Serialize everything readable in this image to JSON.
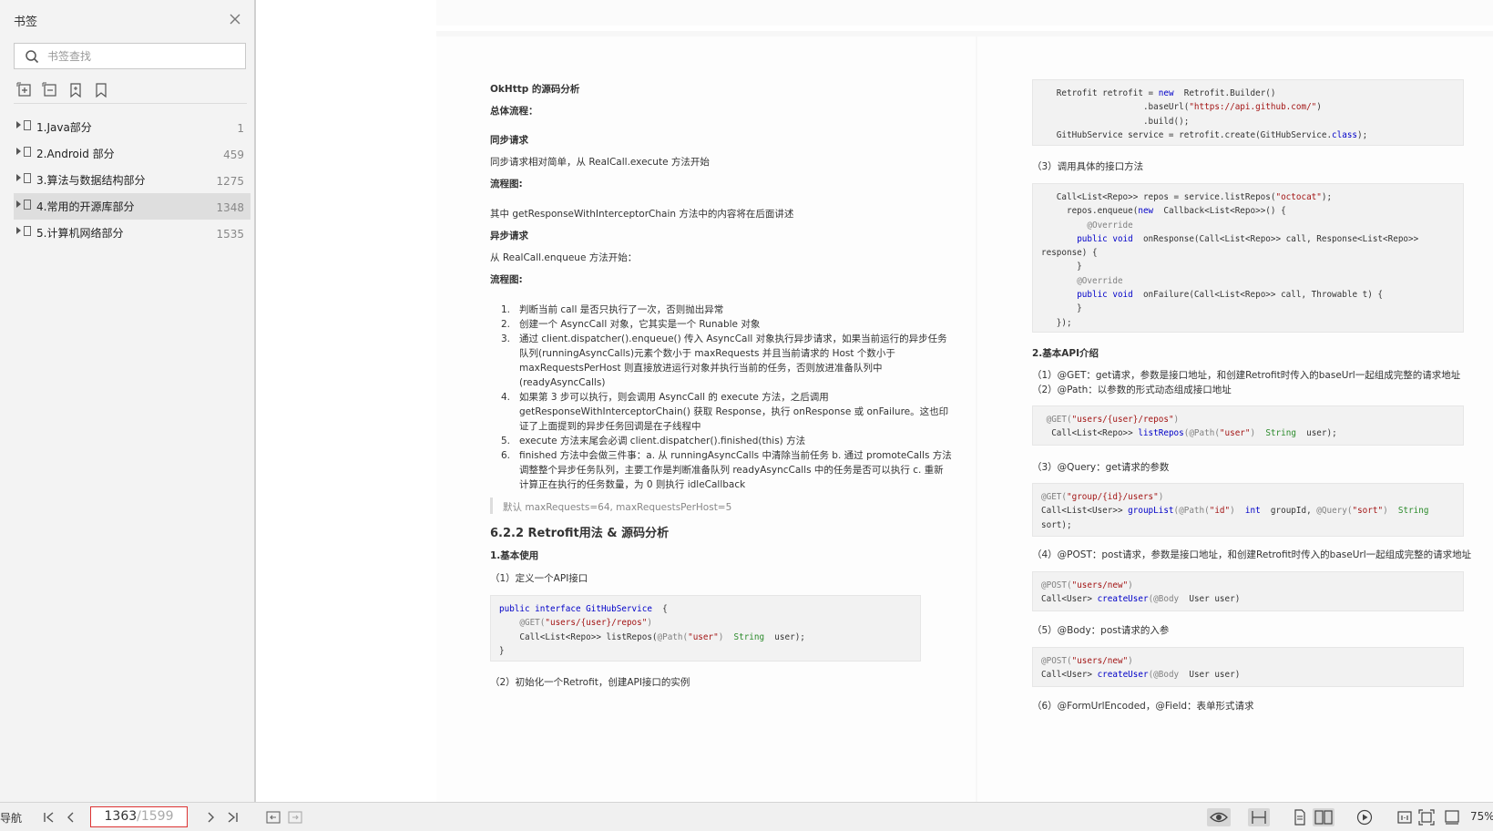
{
  "sidebar": {
    "title": "书签",
    "search_placeholder": "书签查找",
    "items": [
      {
        "label": "1.Java部分",
        "page": "1"
      },
      {
        "label": "2.Android 部分",
        "page": "459"
      },
      {
        "label": "3.算法与数据结构部分",
        "page": "1275"
      },
      {
        "label": "4.常用的开源库部分",
        "page": "1348"
      },
      {
        "label": "5.计算机网络部分",
        "page": "1535"
      }
    ]
  },
  "left_page": {
    "h_okhttp": "OkHttp 的源码分析",
    "overall_flow": "总体流程：",
    "sync_title": "同步请求",
    "sync_desc": "同步请求相对简单，从 RealCall.execute 方法开始",
    "flowchart1": "流程图:",
    "intercept_note": "其中 getResponseWithInterceptorChain 方法中的内容将在后面讲述",
    "async_title": "异步请求",
    "async_desc": "从 RealCall.enqueue 方法开始：",
    "flowchart2": "流程图:",
    "steps": [
      {
        "n": "1.",
        "lines": [
          "判断当前 call 是否只执行了一次，否则抛出异常"
        ]
      },
      {
        "n": "2.",
        "lines": [
          "创建一个 AsyncCall 对象，它其实是一个 Runable 对象"
        ]
      },
      {
        "n": "3.",
        "lines": [
          "通过 client.dispatcher().enqueue() 传入 AsyncCall 对象执行异步请求，如果当前运行的异步任务",
          "队列(runningAsyncCalls)元素个数小于 maxRequests 并且当前请求的 Host 个数小于",
          "maxRequestsPerHost 则直接放进运行对象并执行当前的任务，否则放进准备队列中",
          "(readyAsyncCalls)"
        ]
      },
      {
        "n": "4.",
        "lines": [
          "如果第 3 步可以执行，则会调用 AsyncCall 的 execute 方法，之后调用",
          "getResponseWithInterceptorChain() 获取 Response，执行 onResponse 或 onFailure。这也印",
          "证了上面提到的异步任务回调是在子线程中"
        ]
      },
      {
        "n": "5.",
        "lines": [
          "execute 方法末尾会必调 client.dispatcher().finished(this) 方法"
        ]
      },
      {
        "n": "6.",
        "lines": [
          "finished 方法中会做三件事：a. 从 runningAsyncCalls 中清除当前任务 b. 通过 promoteCalls 方法",
          "调整整个异步任务队列，主要工作是判断准备队列 readyAsyncCalls 中的任务是否可以执行 c. 重新",
          "计算正在执行的任务数量，为 0 则执行 idleCallback"
        ]
      }
    ],
    "quote": "默认 maxRequests=64, maxRequestsPerHost=5",
    "h_retrofit": "6.2.2 Retrofit用法 & 源码分析",
    "basic_use": "1.基本使用",
    "define_api": "（1）定义一个API接口",
    "code1": [
      [
        [
          "kw",
          "public interface "
        ],
        [
          "kw",
          "GitHubService"
        ],
        [
          "",
          "  {"
        ]
      ],
      [
        [
          "",
          "    "
        ],
        [
          "ann",
          "@GET("
        ],
        [
          "str",
          "\"users/{user}/repos\""
        ],
        [
          "ann",
          ")"
        ]
      ],
      [
        [
          "",
          "    Call<List<Repo>> listRepos("
        ],
        [
          "ann",
          "@Path("
        ],
        [
          "str",
          "\"user\""
        ],
        [
          "ann",
          ")"
        ],
        [
          "",
          "  "
        ],
        [
          "ty",
          "String"
        ],
        [
          "",
          "  user);"
        ]
      ],
      [
        [
          "",
          "}"
        ]
      ]
    ],
    "init_retrofit": "（2）初始化一个Retrofit，创建API接口的实例"
  },
  "right_page": {
    "code2": [
      [
        [
          "",
          "   Retrofit retrofit = "
        ],
        [
          "kw",
          "new"
        ],
        [
          "",
          "  Retrofit.Builder()"
        ]
      ],
      [
        [
          "",
          "                    .baseUrl("
        ],
        [
          "str",
          "\"https://api.github.com/\""
        ],
        [
          "",
          ")"
        ]
      ],
      [
        [
          "",
          "                    .build();"
        ]
      ],
      [
        [
          "",
          "   GitHubService service = retrofit.create(GitHubService."
        ],
        [
          "kw",
          "class"
        ],
        [
          "",
          ");"
        ]
      ]
    ],
    "call_method": "（3）调用具体的接口方法",
    "code3": [
      [
        [
          "",
          "   Call<List<Repo>> repos = service.listRepos("
        ],
        [
          "str",
          "\"octocat\""
        ],
        [
          "",
          ");"
        ]
      ],
      [
        [
          "",
          "     repos.enqueue("
        ],
        [
          "kw",
          "new"
        ],
        [
          "",
          "  Callback<List<Repo>>() {"
        ]
      ],
      [
        [
          "",
          "         "
        ],
        [
          "ann",
          "@Override"
        ]
      ],
      [
        [
          "",
          "       "
        ],
        [
          "kw",
          "public void"
        ],
        [
          "",
          "  onResponse(Call<List<Repo>> call, Response<List<Repo>>"
        ]
      ],
      [
        [
          "",
          "response) {"
        ]
      ],
      [
        [
          "",
          "       }"
        ]
      ],
      [
        [
          "",
          "       "
        ],
        [
          "ann",
          "@Override"
        ]
      ],
      [
        [
          "",
          "       "
        ],
        [
          "kw",
          "public void"
        ],
        [
          "",
          "  onFailure(Call<List<Repo>> call, Throwable t) {"
        ]
      ],
      [
        [
          "",
          "       }"
        ]
      ],
      [
        [
          "",
          "   });"
        ]
      ]
    ],
    "api_intro": "2.基本API介绍",
    "api_get": "（1）@GET：get请求，参数是接口地址，和创建Retrofit时传入的baseUrl一起组成完整的请求地址",
    "api_path": "（2）@Path：以参数的形式动态组成接口地址",
    "code4": [
      [
        [
          "ann",
          " @GET("
        ],
        [
          "str",
          "\"users/{user}/repos\""
        ],
        [
          "ann",
          ")"
        ]
      ],
      [
        [
          "",
          "  Call<List<Repo>> "
        ],
        [
          "kw",
          "listRepos"
        ],
        [
          "",
          ""
        ],
        [
          "ann",
          "(@Path("
        ],
        [
          "str",
          "\"user\""
        ],
        [
          "ann",
          ")"
        ],
        [
          "",
          "  "
        ],
        [
          "ty",
          "String"
        ],
        [
          "",
          "  user);"
        ]
      ]
    ],
    "api_query": "（3）@Query：get请求的参数",
    "code5": [
      [
        [
          "ann",
          "@GET("
        ],
        [
          "str",
          "\"group/{id}/users\""
        ],
        [
          "ann",
          ")"
        ]
      ],
      [
        [
          "",
          "Call<List<User>> "
        ],
        [
          "kw",
          "groupList"
        ],
        [
          "ann",
          "(@Path("
        ],
        [
          "str",
          "\"id\""
        ],
        [
          "ann",
          ")"
        ],
        [
          "",
          "  "
        ],
        [
          "kw",
          "int"
        ],
        [
          "",
          "  groupId, "
        ],
        [
          "ann",
          "@Query("
        ],
        [
          "str",
          "\"sort\""
        ],
        [
          "ann",
          ")"
        ],
        [
          "",
          "  "
        ],
        [
          "ty",
          "String"
        ]
      ],
      [
        [
          "",
          "sort);"
        ]
      ]
    ],
    "api_post": "（4）@POST：post请求，参数是接口地址，和创建Retrofit时传入的baseUrl一起组成完整的请求地址",
    "code6": [
      [
        [
          "ann",
          "@POST("
        ],
        [
          "str",
          "\"users/new\""
        ],
        [
          "ann",
          ")"
        ]
      ],
      [
        [
          "",
          "Call<User> "
        ],
        [
          "kw",
          "createUser"
        ],
        [
          "ann",
          "(@Body"
        ],
        [
          "",
          "  User user)"
        ]
      ]
    ],
    "api_body": "（5）@Body：post请求的入参",
    "code7": [
      [
        [
          "ann",
          "@POST("
        ],
        [
          "str",
          "\"users/new\""
        ],
        [
          "ann",
          ")"
        ]
      ],
      [
        [
          "",
          "Call<User> "
        ],
        [
          "kw",
          "createUser"
        ],
        [
          "ann",
          "(@Body"
        ],
        [
          "",
          "  User user)"
        ]
      ]
    ],
    "api_form": "（6）@FormUrlEncoded，@Field：表单形式请求"
  },
  "bottom": {
    "nav_label": "导航",
    "current_page": "1363",
    "total_pages": "/1599",
    "zoom": "75%"
  }
}
